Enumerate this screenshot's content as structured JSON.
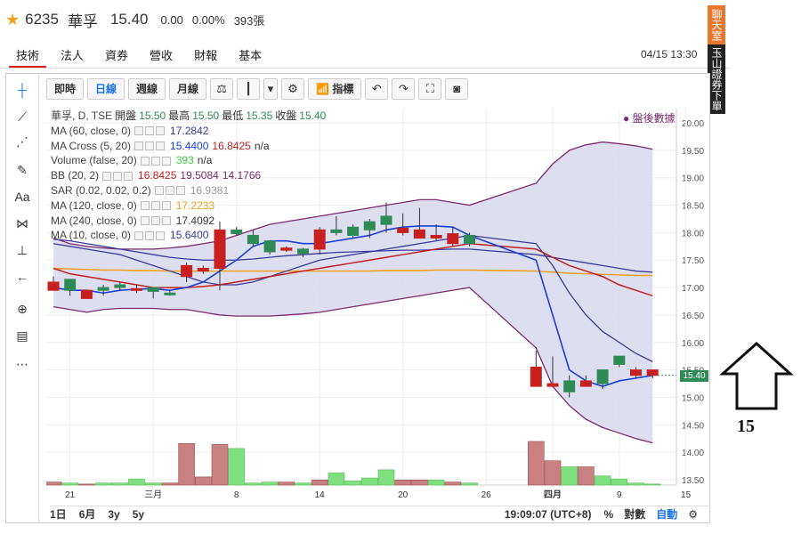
{
  "header": {
    "code": "6235",
    "name": "華孚",
    "price": "15.40",
    "change": "0.00",
    "change_pct": "0.00%",
    "volume": "393張"
  },
  "tabs": [
    "技術",
    "法人",
    "資券",
    "營收",
    "財報",
    "基本"
  ],
  "datetime": "04/15 13:30",
  "side_buttons": {
    "chatroom": "聊天室",
    "broker": "玉山證券下單"
  },
  "toolbar": {
    "items": [
      "即時",
      "日線",
      "週線",
      "月線"
    ],
    "selected": "日線",
    "indicators_label": "指標"
  },
  "legend": {
    "title": "華孚, D, TSE",
    "ohlc": {
      "open_label": "開盤",
      "open": "15.50",
      "high_label": "最高",
      "high": "15.50",
      "low_label": "最低",
      "low": "15.35",
      "close_label": "收盤",
      "close": "15.40"
    },
    "after_hours": "● 盤後數據",
    "studies": [
      {
        "name": "MA (60, close, 0)",
        "values": [
          "17.2842"
        ],
        "colors": [
          "#3a3a9a"
        ]
      },
      {
        "name": "MA Cross (5, 20)",
        "values": [
          "15.4400",
          "16.8425",
          "n/a"
        ],
        "colors": [
          "#1a3fd8",
          "#c02020",
          "#333333"
        ]
      },
      {
        "name": "Volume (false, 20)",
        "values": [
          "393",
          "n/a"
        ],
        "colors": [
          "#3cd03c",
          "#333333"
        ]
      },
      {
        "name": "BB (20, 2)",
        "values": [
          "16.8425",
          "19.5084",
          "14.1766"
        ],
        "colors": [
          "#c02020",
          "#7a2a6e",
          "#7a2a6e"
        ]
      },
      {
        "name": "SAR (0.02, 0.02, 0.2)",
        "values": [
          "16.9381"
        ],
        "colors": [
          "#999999"
        ]
      },
      {
        "name": "MA (120, close, 0)",
        "values": [
          "17.2233"
        ],
        "colors": [
          "#f0a020"
        ]
      },
      {
        "name": "MA (240, close, 0)",
        "values": [
          "17.4092"
        ],
        "colors": [
          "#333333"
        ]
      },
      {
        "name": "MA (10, close, 0)",
        "values": [
          "15.6400"
        ],
        "colors": [
          "#3a3a9a"
        ]
      }
    ]
  },
  "chart_data": {
    "type": "candlestick",
    "y_ticks": [
      "20.00",
      "19.50",
      "19.00",
      "18.50",
      "18.00",
      "17.50",
      "17.00",
      "16.50",
      "16.00",
      "15.50",
      "15.00",
      "14.50",
      "14.00",
      "13.50"
    ],
    "ylim": [
      13.5,
      20.0
    ],
    "x_tick_labels": [
      "21",
      "三月",
      "8",
      "14",
      "20",
      "26",
      "四月",
      "9",
      "15"
    ],
    "x_tick_index": [
      1,
      6,
      11,
      16,
      21,
      26,
      30,
      34,
      38
    ],
    "candles": [
      {
        "o": 17.1,
        "h": 17.2,
        "l": 16.95,
        "c": 16.95
      },
      {
        "o": 16.95,
        "h": 17.15,
        "l": 16.85,
        "c": 17.15
      },
      {
        "o": 16.95,
        "h": 16.95,
        "l": 16.8,
        "c": 16.8
      },
      {
        "o": 16.95,
        "h": 17.05,
        "l": 16.85,
        "c": 17.0
      },
      {
        "o": 17.0,
        "h": 17.1,
        "l": 16.95,
        "c": 17.05
      },
      {
        "o": 16.98,
        "h": 17.05,
        "l": 16.9,
        "c": 16.95
      },
      {
        "o": 16.93,
        "h": 17.0,
        "l": 16.8,
        "c": 17.0
      },
      {
        "o": 16.9,
        "h": 16.95,
        "l": 16.85,
        "c": 16.9
      },
      {
        "o": 17.4,
        "h": 17.45,
        "l": 17.1,
        "c": 17.2
      },
      {
        "o": 17.35,
        "h": 17.4,
        "l": 17.25,
        "c": 17.3
      },
      {
        "o": 18.05,
        "h": 18.2,
        "l": 16.95,
        "c": 17.35
      },
      {
        "o": 17.98,
        "h": 18.1,
        "l": 17.95,
        "c": 18.05
      },
      {
        "o": 17.8,
        "h": 18.05,
        "l": 17.75,
        "c": 17.95
      },
      {
        "o": 17.65,
        "h": 17.85,
        "l": 17.6,
        "c": 17.85
      },
      {
        "o": 17.72,
        "h": 17.75,
        "l": 17.65,
        "c": 17.68
      },
      {
        "o": 17.62,
        "h": 17.72,
        "l": 17.55,
        "c": 17.7
      },
      {
        "o": 18.05,
        "h": 18.1,
        "l": 17.6,
        "c": 17.7
      },
      {
        "o": 18.0,
        "h": 18.3,
        "l": 17.95,
        "c": 18.05
      },
      {
        "o": 17.95,
        "h": 18.15,
        "l": 17.9,
        "c": 18.1
      },
      {
        "o": 18.05,
        "h": 18.25,
        "l": 17.9,
        "c": 18.2
      },
      {
        "o": 18.15,
        "h": 18.55,
        "l": 18.0,
        "c": 18.3
      },
      {
        "o": 18.08,
        "h": 18.35,
        "l": 17.95,
        "c": 18.0
      },
      {
        "o": 18.05,
        "h": 18.45,
        "l": 17.9,
        "c": 17.9
      },
      {
        "o": 17.95,
        "h": 18.15,
        "l": 17.85,
        "c": 17.9
      },
      {
        "o": 17.98,
        "h": 18.1,
        "l": 17.75,
        "c": 17.8
      },
      {
        "o": 17.8,
        "h": 18.0,
        "l": 17.75,
        "c": 17.95
      },
      {
        "o": 15.55,
        "h": 15.85,
        "l": 15.2,
        "c": 15.2
      },
      {
        "o": 15.25,
        "h": 15.75,
        "l": 15.2,
        "c": 15.2
      },
      {
        "o": 15.1,
        "h": 15.4,
        "l": 15.0,
        "c": 15.3
      },
      {
        "o": 15.3,
        "h": 15.4,
        "l": 15.2,
        "c": 15.2
      },
      {
        "o": 15.25,
        "h": 15.45,
        "l": 15.15,
        "c": 15.5
      },
      {
        "o": 15.6,
        "h": 15.7,
        "l": 15.55,
        "c": 15.75
      },
      {
        "o": 15.5,
        "h": 15.55,
        "l": 15.35,
        "c": 15.4
      },
      {
        "o": 15.5,
        "h": 15.5,
        "l": 15.35,
        "c": 15.4
      }
    ],
    "candle_index": [
      0,
      1,
      2,
      3,
      4,
      5,
      6,
      7,
      8,
      9,
      10,
      11,
      12,
      13,
      14,
      15,
      16,
      17,
      18,
      19,
      20,
      21,
      22,
      23,
      24,
      25,
      29,
      30,
      31,
      32,
      33,
      34,
      35,
      36
    ],
    "ma5": [
      17.0,
      16.95,
      16.95,
      16.9,
      16.95,
      16.97,
      16.98,
      16.95,
      17.0,
      17.1,
      17.3,
      17.5,
      17.75,
      17.85,
      17.85,
      17.8,
      17.8,
      17.85,
      17.9,
      17.95,
      18.05,
      18.1,
      18.12,
      18.12,
      18.1,
      17.95,
      17.5,
      16.5,
      15.5,
      15.3,
      15.2,
      15.3,
      15.35,
      15.4
    ],
    "ma20": [
      17.35,
      17.25,
      17.2,
      17.15,
      17.1,
      17.05,
      17.0,
      17.0,
      17.0,
      17.02,
      17.05,
      17.1,
      17.15,
      17.2,
      17.25,
      17.3,
      17.35,
      17.4,
      17.45,
      17.5,
      17.55,
      17.6,
      17.65,
      17.7,
      17.75,
      17.8,
      17.7,
      17.55,
      17.4,
      17.3,
      17.2,
      17.05,
      16.95,
      16.85
    ],
    "ma10": [
      17.8,
      17.75,
      17.7,
      17.65,
      17.6,
      17.5,
      17.4,
      17.3,
      17.2,
      17.1,
      17.05,
      17.05,
      17.1,
      17.2,
      17.3,
      17.4,
      17.5,
      17.55,
      17.6,
      17.65,
      17.7,
      17.75,
      17.8,
      17.85,
      17.9,
      17.95,
      17.8,
      17.4,
      16.9,
      16.5,
      16.2,
      16.0,
      15.8,
      15.65
    ],
    "ma60": [
      17.88,
      17.85,
      17.8,
      17.75,
      17.7,
      17.65,
      17.6,
      17.55,
      17.52,
      17.5,
      17.5,
      17.5,
      17.52,
      17.55,
      17.58,
      17.6,
      17.62,
      17.64,
      17.65,
      17.66,
      17.67,
      17.68,
      17.68,
      17.69,
      17.7,
      17.7,
      17.6,
      17.55,
      17.5,
      17.45,
      17.4,
      17.35,
      17.3,
      17.28
    ],
    "ma120": [
      17.35,
      17.34,
      17.33,
      17.32,
      17.32,
      17.31,
      17.31,
      17.3,
      17.3,
      17.3,
      17.3,
      17.3,
      17.3,
      17.3,
      17.3,
      17.3,
      17.3,
      17.3,
      17.3,
      17.3,
      17.31,
      17.31,
      17.31,
      17.32,
      17.32,
      17.32,
      17.3,
      17.28,
      17.26,
      17.25,
      17.24,
      17.23,
      17.22,
      17.22
    ],
    "bb_upper": [
      17.9,
      17.8,
      17.75,
      17.72,
      17.7,
      17.7,
      17.7,
      17.72,
      17.75,
      17.8,
      17.85,
      17.95,
      18.05,
      18.15,
      18.2,
      18.25,
      18.3,
      18.35,
      18.4,
      18.45,
      18.5,
      18.55,
      18.6,
      18.6,
      18.55,
      18.5,
      18.9,
      19.25,
      19.5,
      19.6,
      19.65,
      19.62,
      19.58,
      19.52
    ],
    "bb_lower": [
      16.65,
      16.6,
      16.55,
      16.6,
      16.62,
      16.62,
      16.62,
      16.6,
      16.6,
      16.55,
      16.5,
      16.48,
      16.48,
      16.48,
      16.5,
      16.52,
      16.55,
      16.6,
      16.65,
      16.7,
      16.75,
      16.8,
      16.85,
      16.9,
      16.95,
      17.0,
      15.9,
      15.2,
      14.85,
      14.6,
      14.45,
      14.35,
      14.25,
      14.17
    ],
    "volume_ylim": [
      0,
      5
    ],
    "volumes": [
      {
        "v": 0.3,
        "up": false
      },
      {
        "v": 0.2,
        "up": true
      },
      {
        "v": 0.1,
        "up": false
      },
      {
        "v": 0.2,
        "up": true
      },
      {
        "v": 0.2,
        "up": true
      },
      {
        "v": 0.6,
        "up": true
      },
      {
        "v": 0.2,
        "up": true
      },
      {
        "v": 0.2,
        "up": false
      },
      {
        "v": 4.1,
        "up": false
      },
      {
        "v": 0.8,
        "up": false
      },
      {
        "v": 4.0,
        "up": false
      },
      {
        "v": 3.6,
        "up": true
      },
      {
        "v": 0.2,
        "up": true
      },
      {
        "v": 0.3,
        "up": true
      },
      {
        "v": 0.3,
        "up": false
      },
      {
        "v": 0.2,
        "up": true
      },
      {
        "v": 0.5,
        "up": false
      },
      {
        "v": 1.2,
        "up": true
      },
      {
        "v": 0.4,
        "up": true
      },
      {
        "v": 0.7,
        "up": true
      },
      {
        "v": 1.5,
        "up": true
      },
      {
        "v": 0.5,
        "up": false
      },
      {
        "v": 0.5,
        "up": false
      },
      {
        "v": 0.5,
        "up": true
      },
      {
        "v": 0.3,
        "up": false
      },
      {
        "v": 0.2,
        "up": true
      },
      {
        "v": 4.3,
        "up": false
      },
      {
        "v": 2.4,
        "up": false
      },
      {
        "v": 1.8,
        "up": true
      },
      {
        "v": 1.8,
        "up": false
      },
      {
        "v": 0.9,
        "up": true
      },
      {
        "v": 0.6,
        "up": true
      },
      {
        "v": 0.2,
        "up": true
      },
      {
        "v": 0.1,
        "up": true
      }
    ],
    "volume_index": [
      0,
      1,
      2,
      3,
      4,
      5,
      6,
      7,
      8,
      9,
      10,
      11,
      12,
      13,
      14,
      15,
      16,
      17,
      18,
      19,
      20,
      21,
      22,
      23,
      24,
      25,
      29,
      30,
      31,
      32,
      33,
      34,
      35,
      36
    ],
    "last_price_label": "15.40"
  },
  "bottom": {
    "ranges": [
      "1日",
      "6月",
      "3y",
      "5y"
    ],
    "time": "19:09:07 (UTC+8)",
    "pct": "%",
    "log": "對數",
    "auto": "自動"
  },
  "annotation": {
    "number": "15"
  },
  "colors": {
    "up": "#c8201e",
    "down": "#2e8b57",
    "bb_fill": "#d8d8ee",
    "bb_line": "#7a2a6e"
  }
}
